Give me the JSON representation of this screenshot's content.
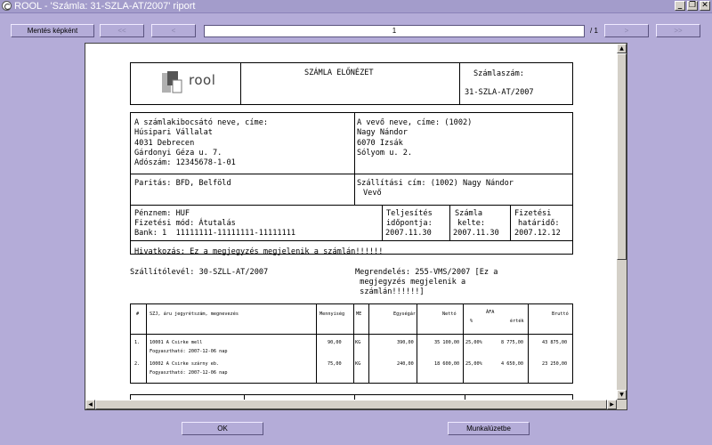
{
  "window": {
    "title": "ROOL  -  'Számla: 31-SZLA-AT/2007' riport"
  },
  "toolbar": {
    "save_image": "Mentés képként",
    "first": "<<",
    "prev": "<",
    "page_value": "1",
    "page_count": "/ 1",
    "next": ">",
    "last": ">>"
  },
  "invoice": {
    "logo_text": "rool",
    "preview_title": "SZÁMLA ELŐNÉZET",
    "invoice_number_label": "Számlaszám:",
    "invoice_number": "31-SZLA-AT/2007",
    "seller_label": "A számlakibocsátó neve, címe:",
    "seller_name": "Húsipari Vállalat",
    "seller_city": "4031 Debrecen",
    "seller_street": "Gárdonyi Géza u. 7.",
    "seller_tax": "Adószám: 12345678-1-01",
    "buyer_label": "A vevő neve, címe: (1002)",
    "buyer_name": "Nagy Nándor",
    "buyer_city": "6070 Izsák",
    "buyer_street": "Sólyom u. 2.",
    "parity": "Paritás: BFD, Belföld",
    "shipping_line1": "Szállítási cím: (1002) Nagy Nándor",
    "shipping_line2": "Vevő",
    "currency": "Pénznem: HUF",
    "payment_method": "Fizetési mód: Átutalás",
    "bank": "Bank: 1  11111111-11111111-11111111",
    "fulfil_label1": "Teljesítés",
    "fulfil_label2": "időpontja:",
    "fulfil_date": "2007.11.30",
    "issue_label1": "Számla",
    "issue_label2": "kelte:",
    "issue_date": "2007.11.30",
    "due_label1": "Fizetési",
    "due_label2": "határidő:",
    "due_date": "2007.12.12",
    "reference": "Hivatkozás: Ez a megjegyzés megjelenik a számlán!!!!!!",
    "delivery_note": "Szállítólevél: 30-SZLL-AT/2007",
    "order_line1": "Megrendelés: 255-VMS/2007 [Ez a",
    "order_line2": " megjegyzés megjelenik a",
    "order_line3": " számlán!!!!!!]"
  },
  "items_table": {
    "headers": {
      "num": "#",
      "name": "SZJ, áru jegyrétszám, megnevezés",
      "qty": "Mennyiség",
      "unit": "ME",
      "unit_price": "Egységár",
      "net": "Nettó",
      "vat": "ÁFA",
      "vat_pct": "%",
      "vat_value": "érték",
      "gross": "Bruttó"
    },
    "rows": [
      {
        "num": "1.",
        "name": "10001 A Csirke mell",
        "expiry": "Fogyasztható: 2007-12-06 nap",
        "qty": "90,00",
        "unit": "KG",
        "unit_price": "390,00",
        "net": "35 100,00",
        "vat_pct": "25,00%",
        "vat_value": "8 775,00",
        "gross": "43 875,00"
      },
      {
        "num": "2.",
        "name": "10002 A Csirke szárny eb.",
        "expiry": "Fogyasztható: 2007-12-06 nap",
        "qty": "75,00",
        "unit": "KG",
        "unit_price": "240,00",
        "net": "18 600,00",
        "vat_pct": "25,00%",
        "vat_value": "4 650,00",
        "gross": "23 250,00"
      }
    ]
  },
  "footer": {
    "ok": "OK",
    "worksheet": "Munkalúzetbe"
  },
  "colors": {
    "window_bg": "#b4acd8",
    "titlebar": "#a39ccb",
    "viewer_bg": "#808080"
  }
}
